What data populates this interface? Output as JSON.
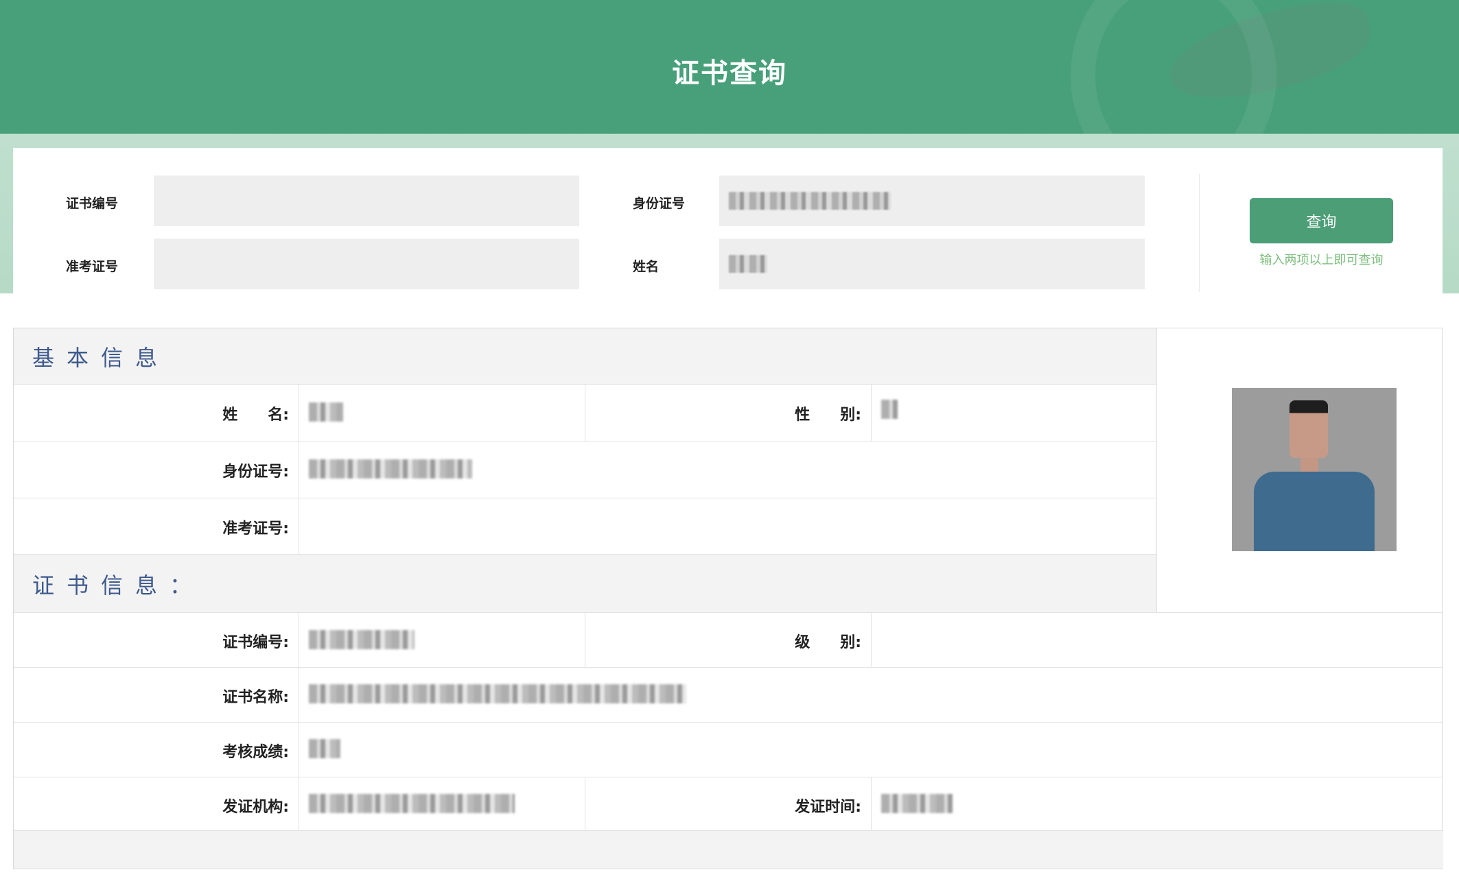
{
  "header": {
    "title": "证书查询"
  },
  "query_form": {
    "cert_no_label": "证书编号",
    "cert_no_value": "",
    "id_no_label": "身份证号",
    "id_no_value": "",
    "exam_no_label": "准考证号",
    "exam_no_value": "",
    "name_label": "姓名",
    "name_value": "",
    "search_button": "查询",
    "hint": "输入两项以上即可查询"
  },
  "basic_info": {
    "title": "基本信息",
    "name_label": "姓　　名:",
    "gender_label": "性　　别:",
    "id_label": "身份证号:",
    "exam_no_label": "准考证号:",
    "exam_no_value": ""
  },
  "cert_info": {
    "title": "证书信息：",
    "cert_no_label": "证书编号:",
    "level_label": "级　　别:",
    "level_value": "",
    "cert_name_label": "证书名称:",
    "score_label": "考核成绩:",
    "issuer_label": "发证机构:",
    "issue_date_label": "发证时间:"
  },
  "colors": {
    "banner": "#47a07a",
    "button": "#4b9e76",
    "hint": "#7fbf80",
    "section_title": "#3d5a8c"
  }
}
